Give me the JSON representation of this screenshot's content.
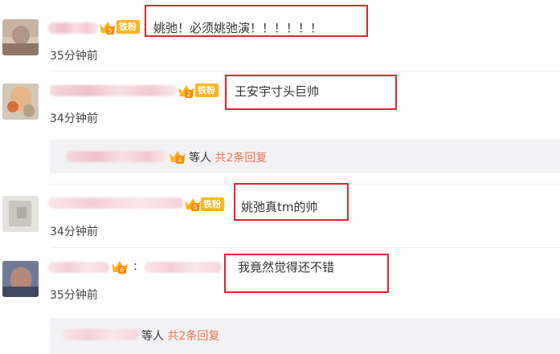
{
  "comments": [
    {
      "text": "姚弛！必须姚弛演！！！！！！",
      "time": "35分钟前",
      "badge": "铁粉",
      "crown_level": "5"
    },
    {
      "text": "王安宇寸头巨帅",
      "time": "34分钟前",
      "badge": "铁粉",
      "crown_level": "2",
      "reply": {
        "suffix": "等人",
        "count_label": "共2条回复",
        "crown_level": "4"
      }
    },
    {
      "text": "姚弛真tm的帅",
      "time": "34分钟前",
      "badge": "铁粉",
      "crown_level": "5"
    },
    {
      "text": "我竟然觉得还不错",
      "time": "35分钟前",
      "crown_level": "6",
      "reply": {
        "suffix": "等人",
        "count_label": "共2条回复"
      }
    }
  ],
  "colors": {
    "highlight": "#e5202f",
    "badge": "#ffb322",
    "reply_accent": "#eb7350"
  }
}
